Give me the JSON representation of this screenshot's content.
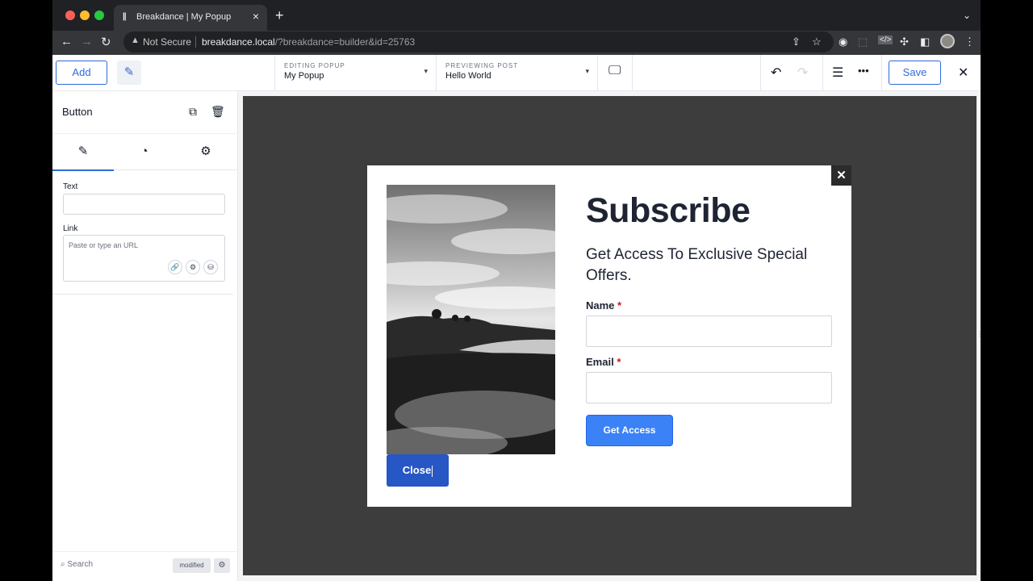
{
  "browser": {
    "tab_title": "Breakdance | My Popup",
    "security_label": "Not Secure",
    "url_host": "breakdance.local",
    "url_path": "/?breakdance=builder&id=25763"
  },
  "topbar": {
    "add_label": "Add",
    "editing_label": "EDITING POPUP",
    "editing_value": "My Popup",
    "previewing_label": "PREVIEWING POST",
    "previewing_value": "Hello World",
    "save_label": "Save"
  },
  "panel": {
    "title": "Button",
    "text_label": "Text",
    "text_value": "",
    "link_label": "Link",
    "link_placeholder": "Paste or type an URL",
    "search_label": "Search",
    "modified_badge": "modified"
  },
  "popup": {
    "heading": "Subscribe",
    "subheading": "Get Access To Exclusive Special Offers.",
    "name_label": "Name",
    "email_label": "Email",
    "required_mark": "*",
    "submit_label": "Get Access",
    "close_label": "Close",
    "close_x": "✕"
  },
  "colors": {
    "accent": "#2f6bd8",
    "submit_button": "#3b82f6",
    "close_button": "#2756c5",
    "canvas": "#3d3d3d",
    "heading_text": "#1f2433"
  }
}
